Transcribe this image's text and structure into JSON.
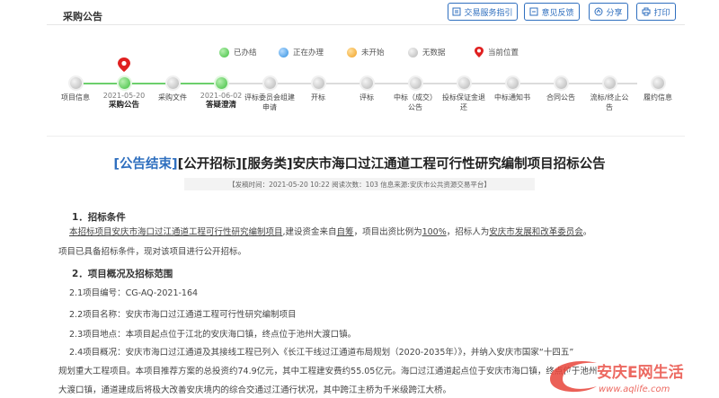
{
  "header": {
    "title": "采购公告",
    "buttons": [
      {
        "label": "交易服务指引",
        "icon": "guide-icon"
      },
      {
        "label": "意见反馈",
        "icon": "feedback-icon"
      },
      {
        "label": "分享",
        "icon": "share-icon"
      },
      {
        "label": "打印",
        "icon": "print-icon"
      }
    ]
  },
  "legend": [
    {
      "label": "已办结",
      "color": "#3fbf3f"
    },
    {
      "label": "正在办理",
      "color": "#2f8fe0"
    },
    {
      "label": "未开始",
      "color": "#f0a020"
    },
    {
      "label": "无数据",
      "color": "#b5b5b5"
    },
    {
      "label": "当前位置",
      "color": "#e02020"
    }
  ],
  "steps": [
    {
      "label": "项目信息",
      "done": false
    },
    {
      "label": "采购公告",
      "date": "2021-05-20",
      "done": true,
      "current": true
    },
    {
      "label": "采购文件",
      "done": false
    },
    {
      "label": "答疑澄清",
      "date": "2021-06-02",
      "done": true
    },
    {
      "label": "评标委员会组建申请",
      "done": false
    },
    {
      "label": "开标",
      "done": false
    },
    {
      "label": "评标",
      "done": false
    },
    {
      "label": "中标（成交）公告",
      "done": false
    },
    {
      "label": "投标保证金退还",
      "done": false
    },
    {
      "label": "中标通知书",
      "done": false
    },
    {
      "label": "合同公告",
      "done": false
    },
    {
      "label": "流标/终止公告",
      "done": false
    },
    {
      "label": "履约信息",
      "done": false
    }
  ],
  "article": {
    "status_tag": "[公告结束]",
    "title_rest": "[公开招标][服务类]安庆市海口过江通道工程可行性研究编制项目招标公告",
    "meta": "【发稿时间：2021-05-20 10:22   阅读次数：103   信息来源:安庆市公共资源交易平台】",
    "s1_heading": "1．招标条件",
    "s1_p1a": "本招标项目安庆市海口过江通道工程可行性研究编制项目",
    "s1_p1b": ",建设资金来自",
    "s1_p1c": "自筹",
    "s1_p1d": "，项目出资比例为",
    "s1_p1e": "100%",
    "s1_p1f": "，招标人为",
    "s1_p1g": "安庆市发展和改革委员会",
    "s1_p1h": "。",
    "s1_p2": "项目已具备招标条件，现对该项目进行公开招标。",
    "s2_heading": "2．项目概况及招标范围",
    "s2_1": "2.1项目编号：CG-AQ-2021-164",
    "s2_2": "2.2项目名称：安庆市海口过江通道工程可行性研究编制项目",
    "s2_3": "2.3项目地点：本项目起点位于江北的安庆海口镇，终点位于池州大渡口镇。",
    "s2_4a": "2.4项目概况：安庆市海口过江通道及其接线工程已列入《长江干线过江通道布局规划（2020-2035年）》，并纳入安庆市国家“十四五”",
    "s2_4b": "规划重大工程项目。本项目推荐方案的总投资约74.9亿元，其中工程建安费约55.05亿元。海口过江通道起点位于安庆市海口镇，终点位于池州",
    "s2_4c": "大渡口镇，通道建成后将极大改善安庆境内的综合交通过江通行状况，其中跨江主桥为千米级跨江大桥。"
  },
  "watermark": {
    "text": "安庆E网生活",
    "url": "www.aqlife.com"
  }
}
